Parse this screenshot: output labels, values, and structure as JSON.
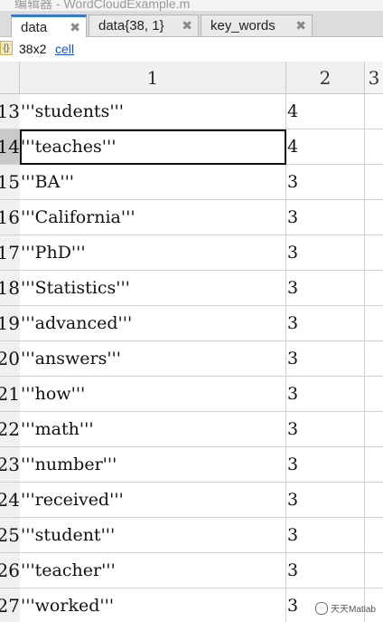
{
  "window": {
    "title": "编辑器 - WordCloudExample.m"
  },
  "tabs": [
    {
      "label": "data",
      "active": true
    },
    {
      "label": "data{38, 1}",
      "active": false
    },
    {
      "label": "key_words",
      "active": false
    }
  ],
  "close_glyph": "✖",
  "info": {
    "icon": "{}",
    "size": "38x2",
    "type": "cell"
  },
  "columns": [
    "1",
    "2",
    "3"
  ],
  "rows": [
    {
      "index": "13",
      "word": "'''students'''",
      "count": "4"
    },
    {
      "index": "14",
      "word": "'''teaches'''",
      "count": "4"
    },
    {
      "index": "15",
      "word": "'''BA'''",
      "count": "3"
    },
    {
      "index": "16",
      "word": "'''California'''",
      "count": "3"
    },
    {
      "index": "17",
      "word": "'''PhD'''",
      "count": "3"
    },
    {
      "index": "18",
      "word": "'''Statistics'''",
      "count": "3"
    },
    {
      "index": "19",
      "word": "'''advanced'''",
      "count": "3"
    },
    {
      "index": "20",
      "word": "'''answers'''",
      "count": "3"
    },
    {
      "index": "21",
      "word": "'''how'''",
      "count": "3"
    },
    {
      "index": "22",
      "word": "'''math'''",
      "count": "3"
    },
    {
      "index": "23",
      "word": "'''number'''",
      "count": "3"
    },
    {
      "index": "24",
      "word": "'''received'''",
      "count": "3"
    },
    {
      "index": "25",
      "word": "'''student'''",
      "count": "3"
    },
    {
      "index": "26",
      "word": "'''teacher'''",
      "count": "3"
    },
    {
      "index": "27",
      "word": "'''worked'''",
      "count": "3"
    }
  ],
  "selected_row": "14",
  "watermark": {
    "text": "天天Matlab"
  }
}
